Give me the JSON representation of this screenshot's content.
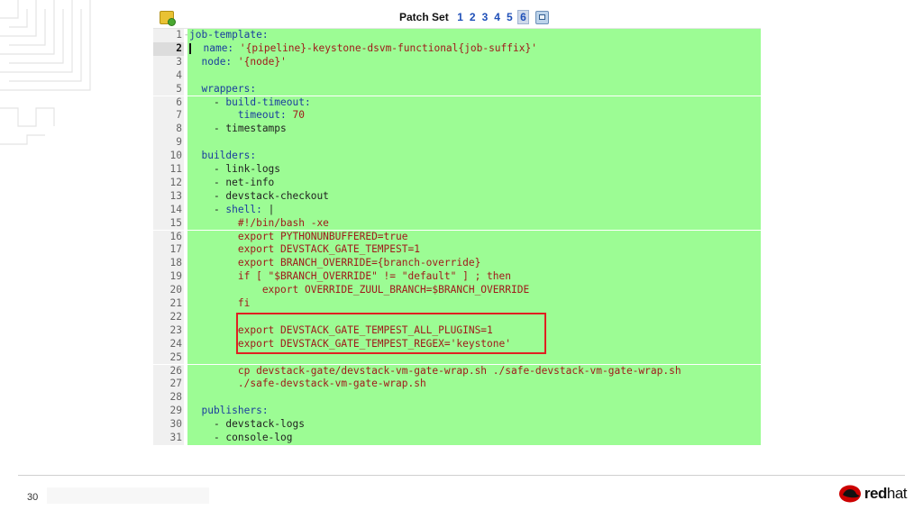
{
  "slide": {
    "page_number": "30"
  },
  "brand": {
    "name_bold": "red",
    "name_rest": "hat",
    "color": "#cc0000"
  },
  "viewer": {
    "patch_set_label": "Patch Set",
    "patch_sets": [
      "1",
      "2",
      "3",
      "4",
      "5",
      "6"
    ],
    "active_patch_set": "6",
    "diff_add_color": "#9cfc94",
    "highlight_color": "#e02020",
    "lines": [
      {
        "n": "1",
        "fold": "-",
        "t": [
          [
            "k",
            "job-template:"
          ]
        ]
      },
      {
        "n": "2",
        "cur": true,
        "t": [
          [
            "p",
            "  "
          ],
          [
            "k",
            "name:"
          ],
          [
            "p",
            " "
          ],
          [
            "s",
            "'{pipeline}-keystone-dsvm-functional{job-suffix}'"
          ]
        ]
      },
      {
        "n": "3",
        "t": [
          [
            "p",
            "  "
          ],
          [
            "k",
            "node:"
          ],
          [
            "p",
            " "
          ],
          [
            "s",
            "'{node}'"
          ]
        ]
      },
      {
        "n": "4",
        "t": []
      },
      {
        "n": "5",
        "t": [
          [
            "p",
            "  "
          ],
          [
            "k",
            "wrappers:"
          ]
        ]
      },
      {
        "n": "6",
        "t": [
          [
            "p",
            "    - "
          ],
          [
            "k",
            "build-timeout:"
          ]
        ]
      },
      {
        "n": "7",
        "t": [
          [
            "p",
            "        "
          ],
          [
            "k",
            "timeout:"
          ],
          [
            "p",
            " "
          ],
          [
            "s",
            "70"
          ]
        ]
      },
      {
        "n": "8",
        "t": [
          [
            "p",
            "    - timestamps"
          ]
        ]
      },
      {
        "n": "9",
        "t": []
      },
      {
        "n": "10",
        "t": [
          [
            "p",
            "  "
          ],
          [
            "k",
            "builders:"
          ]
        ]
      },
      {
        "n": "11",
        "t": [
          [
            "p",
            "    - link-logs"
          ]
        ]
      },
      {
        "n": "12",
        "t": [
          [
            "p",
            "    - net-info"
          ]
        ]
      },
      {
        "n": "13",
        "t": [
          [
            "p",
            "    - devstack-checkout"
          ]
        ]
      },
      {
        "n": "14",
        "t": [
          [
            "p",
            "    - "
          ],
          [
            "k",
            "shell:"
          ],
          [
            "p",
            " |"
          ]
        ]
      },
      {
        "n": "15",
        "t": [
          [
            "s",
            "        #!/bin/bash -xe"
          ]
        ]
      },
      {
        "n": "16",
        "t": [
          [
            "s",
            "        export PYTHONUNBUFFERED=true"
          ]
        ]
      },
      {
        "n": "17",
        "t": [
          [
            "s",
            "        export DEVSTACK_GATE_TEMPEST=1"
          ]
        ]
      },
      {
        "n": "18",
        "t": [
          [
            "s",
            "        export BRANCH_OVERRIDE={branch-override}"
          ]
        ]
      },
      {
        "n": "19",
        "t": [
          [
            "s",
            "        if [ \"$BRANCH_OVERRIDE\" != \"default\" ] ; then"
          ]
        ]
      },
      {
        "n": "20",
        "t": [
          [
            "s",
            "            export OVERRIDE_ZUUL_BRANCH=$BRANCH_OVERRIDE"
          ]
        ]
      },
      {
        "n": "21",
        "t": [
          [
            "s",
            "        fi"
          ]
        ]
      },
      {
        "n": "22",
        "t": []
      },
      {
        "n": "23",
        "t": [
          [
            "s",
            "        export DEVSTACK_GATE_TEMPEST_ALL_PLUGINS=1"
          ]
        ]
      },
      {
        "n": "24",
        "t": [
          [
            "s",
            "        export DEVSTACK_GATE_TEMPEST_REGEX='keystone'"
          ]
        ]
      },
      {
        "n": "25",
        "t": []
      },
      {
        "n": "26",
        "t": [
          [
            "s",
            "        cp devstack-gate/devstack-vm-gate-wrap.sh ./safe-devstack-vm-gate-wrap.sh"
          ]
        ]
      },
      {
        "n": "27",
        "t": [
          [
            "s",
            "        ./safe-devstack-vm-gate-wrap.sh"
          ]
        ]
      },
      {
        "n": "28",
        "t": []
      },
      {
        "n": "29",
        "t": [
          [
            "p",
            "  "
          ],
          [
            "k",
            "publishers:"
          ]
        ]
      },
      {
        "n": "30",
        "t": [
          [
            "p",
            "    - devstack-logs"
          ]
        ]
      },
      {
        "n": "31",
        "t": [
          [
            "p",
            "    - console-log"
          ]
        ]
      }
    ]
  }
}
